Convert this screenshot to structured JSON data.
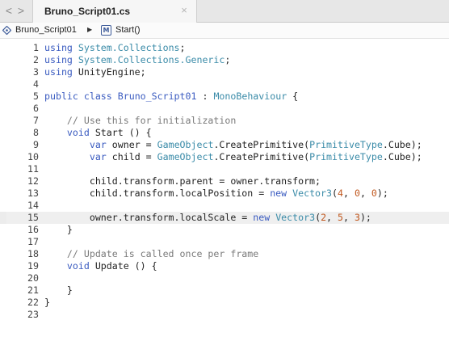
{
  "tab": {
    "title": "Bruno_Script01.cs"
  },
  "nav": {
    "back": "<",
    "forward": ">",
    "close": "×"
  },
  "breadcrumb": {
    "file": "Bruno_Script01",
    "separator": "▶",
    "method_badge": "M",
    "method": "Start()"
  },
  "editor": {
    "current_line": 15,
    "lines": [
      {
        "n": "1",
        "tokens": [
          {
            "t": "kw",
            "v": "using"
          },
          {
            "t": "pl",
            "v": " "
          },
          {
            "t": "ty",
            "v": "System.Collections"
          },
          {
            "t": "pl",
            "v": ";"
          }
        ]
      },
      {
        "n": "2",
        "tokens": [
          {
            "t": "kw",
            "v": "using"
          },
          {
            "t": "pl",
            "v": " "
          },
          {
            "t": "ty",
            "v": "System.Collections.Generic"
          },
          {
            "t": "pl",
            "v": ";"
          }
        ]
      },
      {
        "n": "3",
        "tokens": [
          {
            "t": "kw",
            "v": "using"
          },
          {
            "t": "pl",
            "v": " UnityEngine;"
          }
        ]
      },
      {
        "n": "4",
        "tokens": []
      },
      {
        "n": "5",
        "tokens": [
          {
            "t": "kw",
            "v": "public class"
          },
          {
            "t": "pl",
            "v": " "
          },
          {
            "t": "kw",
            "v": "Bruno_Script01"
          },
          {
            "t": "pl",
            "v": " : "
          },
          {
            "t": "ty",
            "v": "MonoBehaviour"
          },
          {
            "t": "pl",
            "v": " {"
          }
        ]
      },
      {
        "n": "6",
        "tokens": []
      },
      {
        "n": "7",
        "tokens": [
          {
            "t": "pl",
            "v": "    "
          },
          {
            "t": "cm",
            "v": "// Use this for initialization"
          }
        ]
      },
      {
        "n": "8",
        "tokens": [
          {
            "t": "pl",
            "v": "    "
          },
          {
            "t": "kw",
            "v": "void"
          },
          {
            "t": "pl",
            "v": " Start () {"
          }
        ]
      },
      {
        "n": "9",
        "tokens": [
          {
            "t": "pl",
            "v": "        "
          },
          {
            "t": "kw",
            "v": "var"
          },
          {
            "t": "pl",
            "v": " owner = "
          },
          {
            "t": "ty",
            "v": "GameObject"
          },
          {
            "t": "pl",
            "v": ".CreatePrimitive("
          },
          {
            "t": "ty",
            "v": "PrimitiveType"
          },
          {
            "t": "pl",
            "v": ".Cube);"
          }
        ]
      },
      {
        "n": "10",
        "tokens": [
          {
            "t": "pl",
            "v": "        "
          },
          {
            "t": "kw",
            "v": "var"
          },
          {
            "t": "pl",
            "v": " child = "
          },
          {
            "t": "ty",
            "v": "GameObject"
          },
          {
            "t": "pl",
            "v": ".CreatePrimitive("
          },
          {
            "t": "ty",
            "v": "PrimitiveType"
          },
          {
            "t": "pl",
            "v": ".Cube);"
          }
        ]
      },
      {
        "n": "11",
        "tokens": []
      },
      {
        "n": "12",
        "tokens": [
          {
            "t": "pl",
            "v": "        child.transform.parent = owner.transform;"
          }
        ]
      },
      {
        "n": "13",
        "tokens": [
          {
            "t": "pl",
            "v": "        child.transform.localPosition = "
          },
          {
            "t": "kw",
            "v": "new"
          },
          {
            "t": "pl",
            "v": " "
          },
          {
            "t": "ty",
            "v": "Vector3"
          },
          {
            "t": "pl",
            "v": "("
          },
          {
            "t": "nm",
            "v": "4"
          },
          {
            "t": "pl",
            "v": ", "
          },
          {
            "t": "nm",
            "v": "0"
          },
          {
            "t": "pl",
            "v": ", "
          },
          {
            "t": "nm",
            "v": "0"
          },
          {
            "t": "pl",
            "v": ");"
          }
        ]
      },
      {
        "n": "14",
        "tokens": []
      },
      {
        "n": "15",
        "tokens": [
          {
            "t": "pl",
            "v": "        owner.transform.localScale = "
          },
          {
            "t": "kw",
            "v": "new"
          },
          {
            "t": "pl",
            "v": " "
          },
          {
            "t": "ty",
            "v": "Vector3"
          },
          {
            "t": "pl",
            "v": "("
          },
          {
            "t": "nm",
            "v": "2"
          },
          {
            "t": "pl",
            "v": ", "
          },
          {
            "t": "nm",
            "v": "5"
          },
          {
            "t": "pl",
            "v": ", "
          },
          {
            "t": "nm",
            "v": "3"
          },
          {
            "t": "pl",
            "v": ");"
          }
        ]
      },
      {
        "n": "16",
        "tokens": [
          {
            "t": "pl",
            "v": "    }"
          }
        ]
      },
      {
        "n": "17",
        "tokens": []
      },
      {
        "n": "18",
        "tokens": [
          {
            "t": "pl",
            "v": "    "
          },
          {
            "t": "cm",
            "v": "// Update is called once per frame"
          }
        ]
      },
      {
        "n": "19",
        "tokens": [
          {
            "t": "pl",
            "v": "    "
          },
          {
            "t": "kw",
            "v": "void"
          },
          {
            "t": "pl",
            "v": " Update () {"
          }
        ]
      },
      {
        "n": "20",
        "tokens": []
      },
      {
        "n": "21",
        "tokens": [
          {
            "t": "pl",
            "v": "    }"
          }
        ]
      },
      {
        "n": "22",
        "tokens": [
          {
            "t": "pl",
            "v": "}"
          }
        ]
      },
      {
        "n": "23",
        "tokens": []
      }
    ]
  },
  "colors": {
    "keyword": "#3a5bc0",
    "type": "#3a8ba8",
    "comment": "#7a7a7a",
    "number": "#c0571d",
    "plain": "#222222"
  }
}
